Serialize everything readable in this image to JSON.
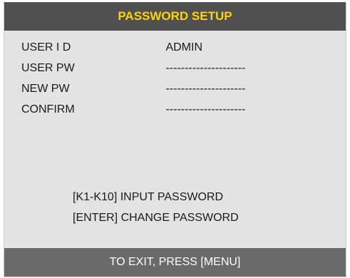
{
  "title": "PASSWORD SETUP",
  "fields": [
    {
      "label": "USER I D",
      "value": "ADMIN"
    },
    {
      "label": "USER PW",
      "value": "---------------------"
    },
    {
      "label": "NEW PW",
      "value": "---------------------"
    },
    {
      "label": "CONFIRM",
      "value": "---------------------"
    }
  ],
  "instructions": [
    "[K1-K10] INPUT PASSWORD",
    "[ENTER] CHANGE PASSWORD"
  ],
  "footer": "TO EXIT, PRESS  [MENU]",
  "colors": {
    "title_background": "#505050",
    "title_text": "#ffd400",
    "panel_background": "#e3e3e3",
    "footer_background": "#6a6a6a",
    "footer_text": "#ffffff"
  }
}
